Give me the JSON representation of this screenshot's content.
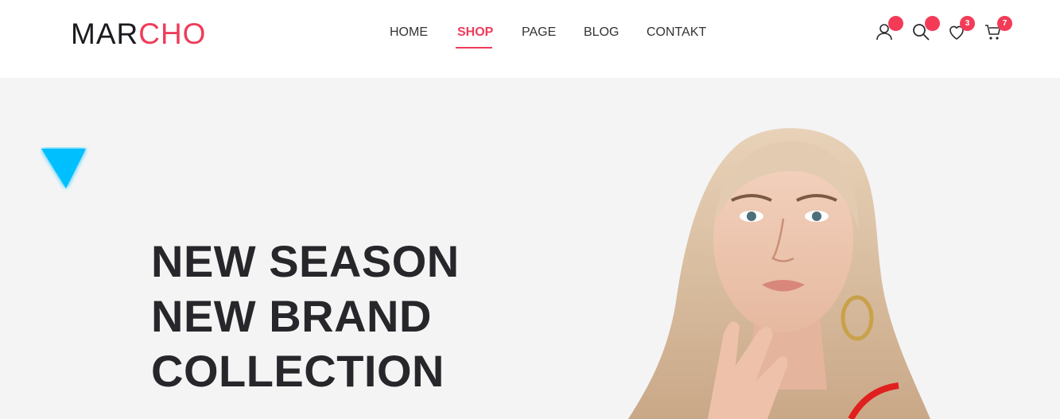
{
  "brand": {
    "part1": "MAR",
    "part2": "CHO"
  },
  "nav": {
    "items": [
      {
        "label": "HOME",
        "active": false
      },
      {
        "label": "SHOP",
        "active": true
      },
      {
        "label": "PAGE",
        "active": false
      },
      {
        "label": "BLOG",
        "active": false
      },
      {
        "label": "CONTAKT",
        "active": false
      }
    ]
  },
  "header_icons": {
    "wishlist_count": "3",
    "cart_count": "7"
  },
  "hero": {
    "lines": [
      "NEW SEASON",
      "NEW BRAND",
      "COLLECTION"
    ]
  },
  "colors": {
    "accent": "#ee3d5b",
    "text_dark": "#27272b",
    "hero_bg": "#f4f4f5",
    "triangle": "#00bfff"
  }
}
